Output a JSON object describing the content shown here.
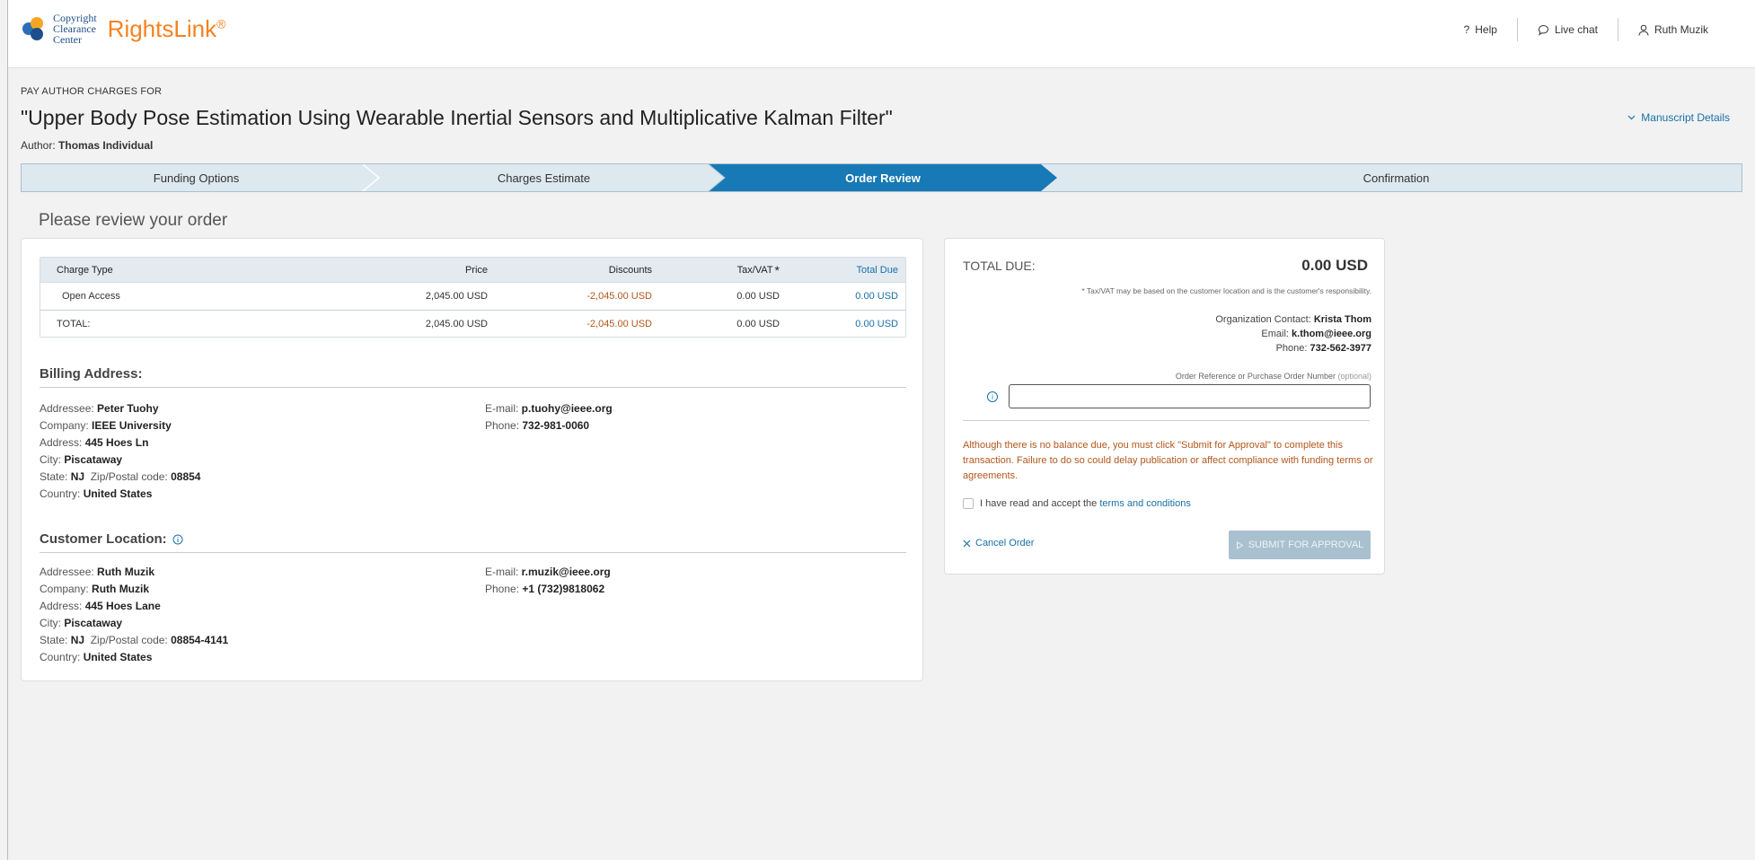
{
  "header": {
    "logo_line1": "Copyright",
    "logo_line2": "Clearance",
    "logo_line3": "Center",
    "brand": "RightsLink",
    "brand_mark": "®",
    "nav": {
      "help": "Help",
      "help_icon": "?",
      "live_chat": "Live chat",
      "user": "Ruth Muzik"
    }
  },
  "page": {
    "pay_label": "PAY AUTHOR CHARGES FOR",
    "title": "\"Upper Body Pose Estimation Using Wearable Inertial Sensors and Multiplicative Kalman Filter\"",
    "author_label": "Author: ",
    "author_name": "Thomas Individual",
    "manuscript_details": "Manuscript Details",
    "review_title": "Please review your order"
  },
  "steps": [
    {
      "label": "Funding Options",
      "active": false
    },
    {
      "label": "Charges Estimate",
      "active": false
    },
    {
      "label": "Order Review",
      "active": true
    },
    {
      "label": "Confirmation",
      "active": false
    }
  ],
  "charges": {
    "headers": {
      "type": "Charge Type",
      "price": "Price",
      "discounts": "Discounts",
      "tax": "Tax/VAT",
      "tax_mark": "*",
      "total": "Total Due"
    },
    "rows": [
      {
        "type": "Open Access",
        "price": "2,045.00 USD",
        "discounts": "-2,045.00 USD",
        "tax": "0.00 USD",
        "total": "0.00 USD"
      }
    ],
    "total_row": {
      "type": "TOTAL:",
      "price": "2,045.00 USD",
      "discounts": "-2,045.00 USD",
      "tax": "0.00 USD",
      "total": "0.00 USD"
    }
  },
  "billing": {
    "heading": "Billing Address:",
    "addressee_label": "Addressee: ",
    "addressee": "Peter Tuohy",
    "company_label": "Company: ",
    "company": "IEEE University",
    "address_label": "Address: ",
    "address": "445 Hoes Ln",
    "city_label": "City: ",
    "city": "Piscataway",
    "state_label": "State: ",
    "state": "NJ",
    "zip_label": "Zip/Postal code: ",
    "zip": "08854",
    "country_label": "Country: ",
    "country": "United States",
    "email_label": "E-mail: ",
    "email": "p.tuohy@ieee.org",
    "phone_label": "Phone: ",
    "phone": "732-981-0060"
  },
  "customer": {
    "heading": "Customer Location:",
    "addressee_label": "Addressee: ",
    "addressee": "Ruth Muzik",
    "company_label": "Company: ",
    "company": "Ruth Muzik",
    "address_label": "Address: ",
    "address": "445 Hoes Lane",
    "city_label": "City: ",
    "city": "Piscataway",
    "state_label": "State: ",
    "state": "NJ",
    "zip_label": "Zip/Postal code: ",
    "zip": "08854-4141",
    "country_label": "Country: ",
    "country": "United States",
    "email_label": "E-mail: ",
    "email": "r.muzik@ieee.org",
    "phone_label": "Phone: ",
    "phone": "+1 (732)9818062"
  },
  "summary": {
    "total_label": "TOTAL DUE:",
    "total_value": "0.00 USD",
    "tax_note": "* Tax/VAT may be based on the customer location and is the customer's responsibility.",
    "org_contact_label": "Organization Contact: ",
    "org_contact": "Krista Thom",
    "email_label": "Email: ",
    "email": "k.thom@ieee.org",
    "phone_label": "Phone: ",
    "phone": "732-562-3977",
    "po_label": "Order Reference or Purchase Order Number ",
    "po_optional": "(optional)",
    "po_value": "",
    "warning": "Although there is no balance due, you must click \"Submit for Approval\" to complete this transaction. Failure to do so could delay publication or affect compliance with funding terms or agreements.",
    "accept_text": "I have read and accept the ",
    "terms_link": "terms and conditions",
    "cancel": "Cancel Order",
    "submit": "SUBMIT FOR APPROVAL"
  },
  "colors": {
    "accent": "#1a6fa8",
    "step_active": "#1779b5",
    "step_inactive": "#dde8ef",
    "warning": "#b2561c",
    "brand_orange": "#f58220",
    "submit_disabled": "#a9c1cf"
  }
}
